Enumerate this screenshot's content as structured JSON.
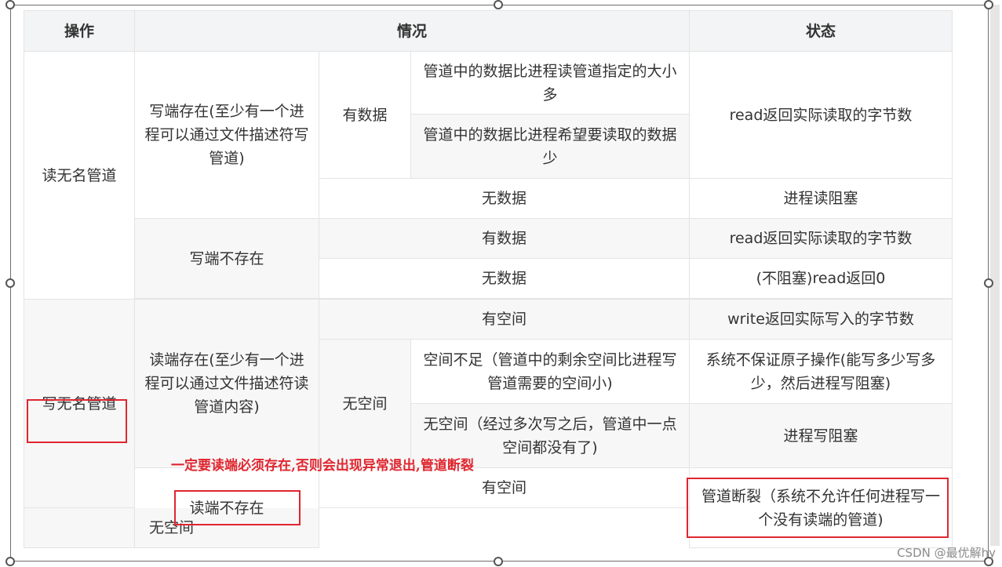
{
  "headers": {
    "operation": "操作",
    "situation": "情况",
    "status": "状态"
  },
  "read_pipe": {
    "operation": "读无名管道",
    "writer_exists": "写端存在(至少有一个进程可以通过文件描述符写管道)",
    "writer_absent": "写端不存在",
    "has_data": "有数据",
    "no_data": "无数据",
    "more_than_requested": "管道中的数据比进程读管道指定的大小多",
    "less_than_wanted": "管道中的数据比进程希望要读取的数据少",
    "status_read_actual": "read返回实际读取的字节数",
    "status_block": "进程读阻塞",
    "status_read_actual_2": "read返回实际读取的字节数",
    "status_nonblock_zero": "(不阻塞)read返回0",
    "has_data_2": "有数据",
    "no_data_2": "无数据"
  },
  "write_pipe": {
    "operation": "写无名管道",
    "reader_exists": "读端存在(至少有一个进程可以通过文件描述符读管道内容)",
    "reader_absent": "读端不存在",
    "has_space": "有空间",
    "no_space": "无空间",
    "insufficient_space": "空间不足（管道中的剩余空间比进程写管道需要的空间小)",
    "zero_space": "无空间（经过多次写之后，管道中一点空间都没有了)",
    "status_write_actual": "write返回实际写入的字节数",
    "status_no_atomic": "系统不保证原子操作(能写多少写多少，然后进程写阻塞)",
    "status_write_block": "进程写阻塞",
    "status_broken_pipe": "管道断裂（系统不允许任何进程写一个没有读端的管道)",
    "has_space_2": "有空间",
    "no_space_2": "无空间"
  },
  "annotation": "一定要读端必须存在,否则会出现异常退出,管道断裂",
  "watermark": "CSDN @最优解hy"
}
